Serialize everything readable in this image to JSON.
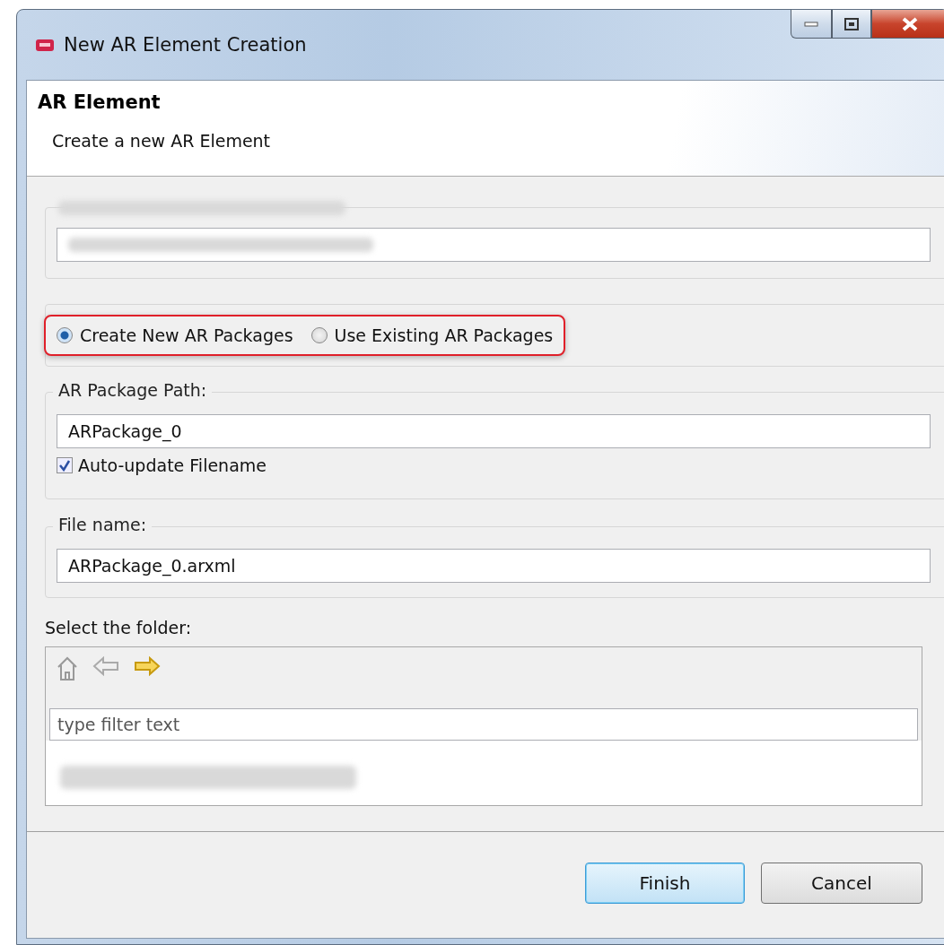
{
  "window": {
    "title": "New AR Element Creation"
  },
  "header": {
    "title": "AR Element",
    "description": "Create a new AR Element"
  },
  "package_mode": [
    {
      "label": "Create New AR Packages",
      "selected": true
    },
    {
      "label": "Use Existing AR Packages",
      "selected": false
    }
  ],
  "package_path": {
    "label": "AR Package Path:",
    "value": "ARPackage_0"
  },
  "auto_update": {
    "label": "Auto-update Filename",
    "checked": true
  },
  "file_name": {
    "label": "File name:",
    "value": "ARPackage_0.arxml"
  },
  "folder": {
    "label": "Select the folder:",
    "filter": {
      "placeholder": "type filter text"
    }
  },
  "buttons": [
    {
      "label": "Finish",
      "default": true
    },
    {
      "label": "Cancel",
      "default": false
    }
  ]
}
